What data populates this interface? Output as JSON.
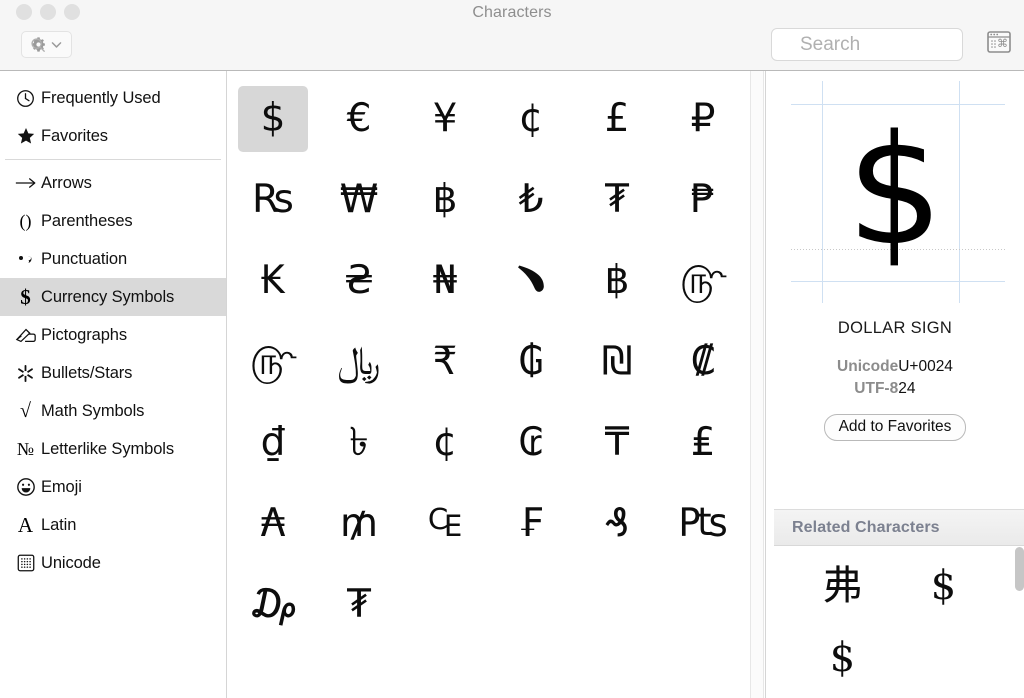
{
  "window": {
    "title": "Characters",
    "traffic_lights": [
      "close",
      "minimize",
      "zoom"
    ]
  },
  "toolbar": {
    "gear_button_label": "",
    "gear_icon": "gear-icon",
    "chevron_icon": "chevron-down-icon",
    "search_placeholder": "Search",
    "search_value": "",
    "search_icon": "search-icon",
    "keyboard_viewer_icon": "keyboard-viewer-icon"
  },
  "sidebar": {
    "groups": [
      {
        "items": [
          {
            "icon": "clock-icon",
            "glyph": "◴",
            "label": "Frequently Used",
            "selected": false
          },
          {
            "icon": "star-icon",
            "glyph": "★",
            "label": "Favorites",
            "selected": false
          }
        ]
      },
      {
        "items": [
          {
            "icon": "arrow-right-icon",
            "glyph": "⟶",
            "label": "Arrows",
            "selected": false
          },
          {
            "icon": "parentheses-icon",
            "glyph": "()",
            "label": "Parentheses",
            "selected": false
          },
          {
            "icon": "punctuation-icon",
            "glyph": "•,",
            "label": "Punctuation",
            "selected": false
          },
          {
            "icon": "dollar-icon",
            "glyph": "$",
            "label": "Currency Symbols",
            "selected": true
          },
          {
            "icon": "pictograph-icon",
            "glyph": "✍",
            "label": "Pictographs",
            "selected": false
          },
          {
            "icon": "asterisk-icon",
            "glyph": "✳",
            "label": "Bullets/Stars",
            "selected": false
          },
          {
            "icon": "radical-icon",
            "glyph": "√",
            "label": "Math Symbols",
            "selected": false
          },
          {
            "icon": "numero-icon",
            "glyph": "№",
            "label": "Letterlike Symbols",
            "selected": false
          },
          {
            "icon": "smiley-icon",
            "glyph": "☺",
            "label": "Emoji",
            "selected": false
          },
          {
            "icon": "letter-a-icon",
            "glyph": "A",
            "label": "Latin",
            "selected": false
          },
          {
            "icon": "unicode-grid-icon",
            "glyph": "▒",
            "label": "Unicode",
            "selected": false
          }
        ]
      }
    ]
  },
  "character_grid": {
    "selected_index": 0,
    "characters": [
      "$",
      "€",
      "¥",
      "¢",
      "£",
      "₽",
      "₨",
      "₩",
      "฿",
      "₺",
      "₮",
      "₱",
      "₭",
      "₴",
      "₦",
      "﹅",
      "฿",
      "௹",
      "௹",
      "﷼",
      "₹",
      "₲",
      "₪",
      "₡",
      "₫",
      "৳",
      "¢",
      "₢",
      "₸",
      "₤",
      "₳",
      "₥",
      "₠",
      "₣",
      "₰",
      "₧",
      "₯",
      "₮"
    ]
  },
  "detail": {
    "preview_glyph": "$",
    "name": "DOLLAR SIGN",
    "fields": [
      {
        "key": "Unicode",
        "value": "U+0024"
      },
      {
        "key": "UTF-8",
        "value": "24"
      }
    ],
    "add_to_favorites_label": "Add to Favorites",
    "related": {
      "header": "Related Characters",
      "characters": [
        "弗",
        "$",
        "$"
      ]
    }
  },
  "colors": {
    "toolbar_bg": "#f6f6f6",
    "selection_gray": "#d9d9d9",
    "guide_blue": "#cfe0f2",
    "related_header_text": "#7c8190",
    "meta_key_gray": "#8c8c8c"
  }
}
